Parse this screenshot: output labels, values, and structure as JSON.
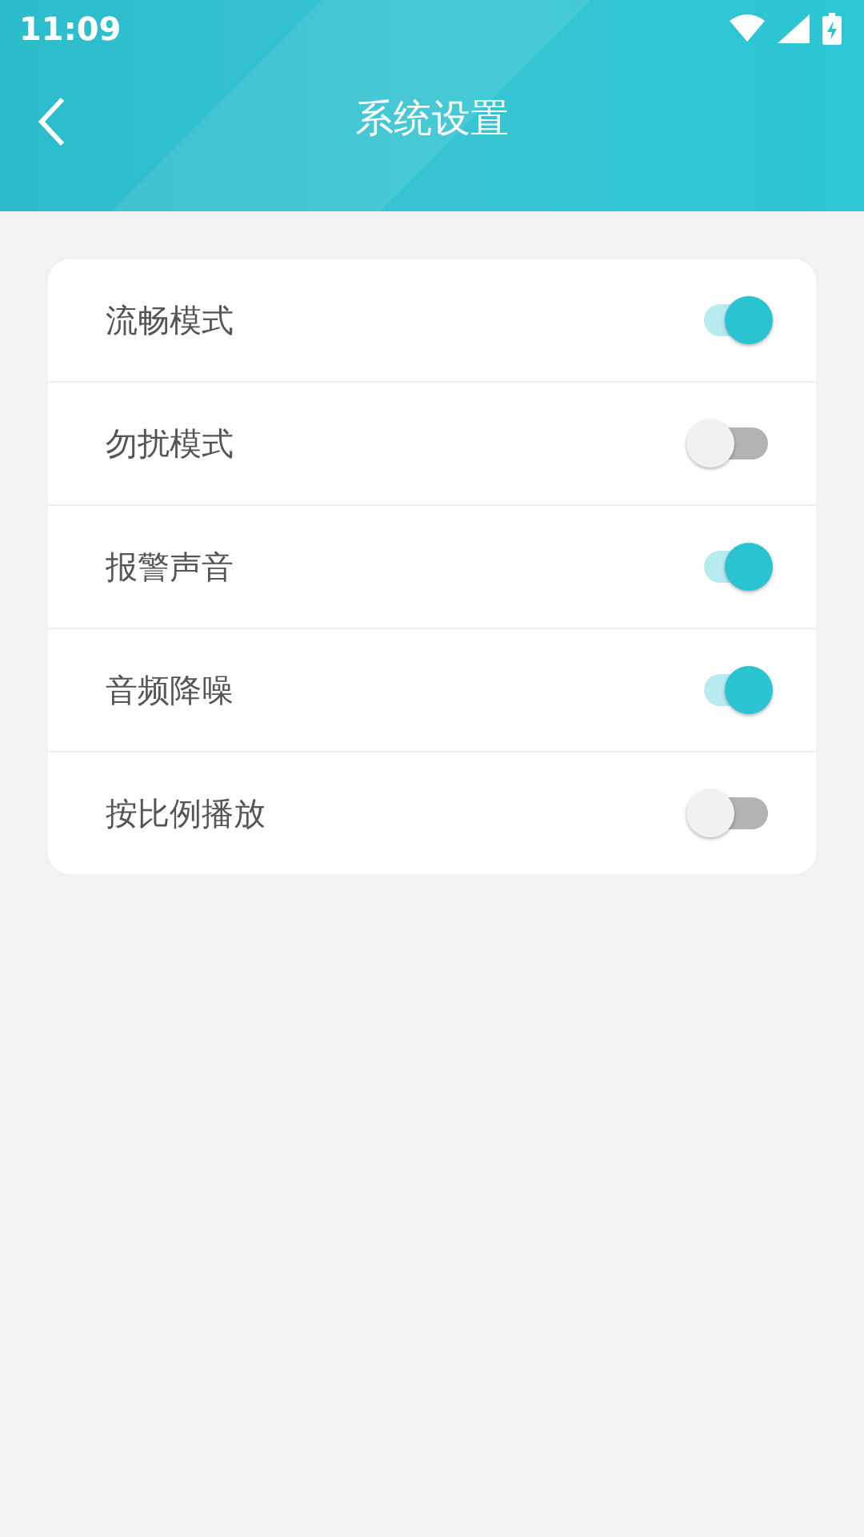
{
  "status_bar": {
    "time": "11:09"
  },
  "header": {
    "title": "系统设置"
  },
  "settings": [
    {
      "label": "流畅模式",
      "on": true
    },
    {
      "label": "勿扰模式",
      "on": false
    },
    {
      "label": "报警声音",
      "on": true
    },
    {
      "label": "音频降噪",
      "on": true
    },
    {
      "label": "按比例播放",
      "on": false
    }
  ]
}
